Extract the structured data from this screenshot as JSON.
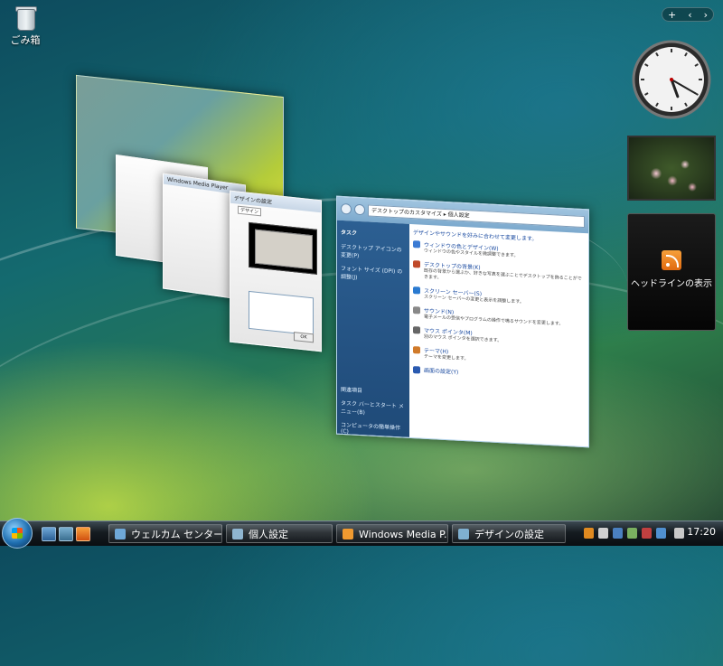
{
  "desktop": {
    "icons": [
      {
        "label": "ごみ箱",
        "icon": "recycle-bin-icon"
      }
    ]
  },
  "sidebar": {
    "controls": {
      "add": "+",
      "prev": "‹",
      "next": "›"
    },
    "clock": {
      "hour": 5,
      "minute": 20
    },
    "feed_gadget": {
      "label": "ヘッドラインの表示",
      "icon": "rss-icon"
    }
  },
  "flip3d": {
    "windows": [
      {
        "title": "Windows Media Player"
      },
      {
        "title": "デザインの設定",
        "tab": "デザイン",
        "button": "OK"
      },
      {
        "address": "デスクトップのカスタマイズ ▸ 個人設定",
        "tasks_heading": "タスク",
        "tasks": [
          "デスクトップ アイコンの変更(P)",
          "フォント サイズ (DPI) の調整(J)"
        ],
        "heading": "デザインやサウンドを好みに合わせて変更します。",
        "items": [
          {
            "title": "ウィンドウの色とデザイン(W)",
            "desc": "ウィンドウの色やスタイルを微調整できます。",
            "color": "#3b7bd4"
          },
          {
            "title": "デスクトップの背景(K)",
            "desc": "既存の背景から選ぶか、好きな写真を選ぶことでデスクトップを飾ることができます。",
            "color": "#c04a2a"
          },
          {
            "title": "スクリーン セーバー(S)",
            "desc": "スクリーン セーバーの変更と表示を調整します。",
            "color": "#2a7ad0"
          },
          {
            "title": "サウンド(N)",
            "desc": "電子メールの受信やプログラムの操作で鳴るサウンドを変更します。",
            "color": "#888888"
          },
          {
            "title": "マウス ポインタ(M)",
            "desc": "別のマウス ポインタを選択できます。",
            "color": "#666666"
          },
          {
            "title": "テーマ(H)",
            "desc": "テーマを変更します。",
            "color": "#d07a2a"
          },
          {
            "title": "画面の設定(Y)",
            "desc": "",
            "color": "#2a5ab0"
          }
        ],
        "see_also": [
          "関連項目",
          "タスク バーとスタート メニュー(B)",
          "コンピュータの簡単操作(C)"
        ]
      }
    ]
  },
  "taskbar": {
    "quick_launch": [
      "show-desktop-icon",
      "switch-windows-icon",
      "media-player-icon"
    ],
    "buttons": [
      {
        "label": "ウェルカム センター",
        "icon": "welcome-center-icon"
      },
      {
        "label": "個人設定",
        "icon": "personalize-icon"
      },
      {
        "label": "Windows Media P...",
        "icon": "media-player-icon"
      },
      {
        "label": "デザインの設定",
        "icon": "appearance-icon"
      }
    ],
    "tray": {
      "time": "17:20"
    }
  },
  "colors": {
    "accent": "#1f6fb0",
    "taskbar": "#151b20"
  }
}
